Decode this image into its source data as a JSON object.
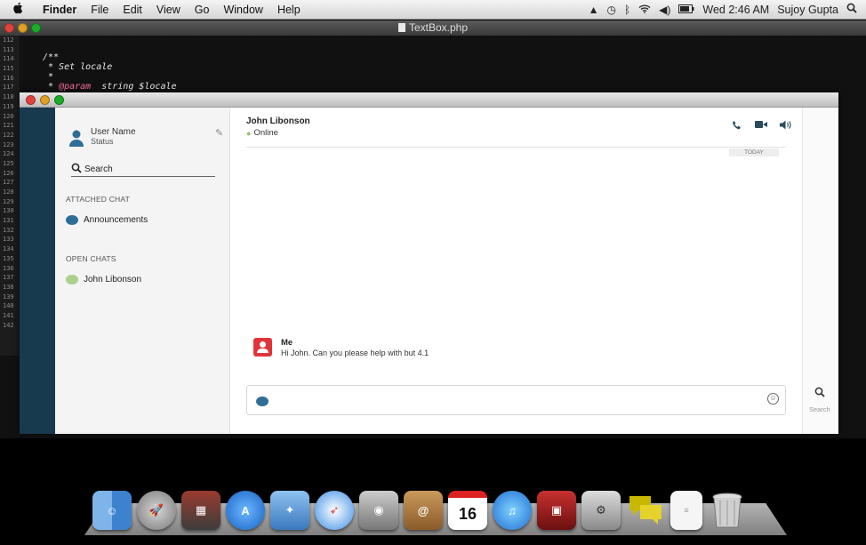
{
  "menubar": {
    "apple": "",
    "items": [
      "Finder",
      "File",
      "Edit",
      "View",
      "Go",
      "Window",
      "Help"
    ],
    "clock": "Wed 2:46 AM",
    "user": "Sujoy Gupta"
  },
  "editor": {
    "title": "TextBox.php",
    "line_numbers": [
      "112",
      "113",
      "114",
      "115",
      "116",
      "117",
      "118",
      "119",
      "120",
      "121",
      "122",
      "123",
      "124",
      "125",
      "126",
      "127",
      "128",
      "129",
      "130",
      "131",
      "132",
      "133",
      "134",
      "135",
      "136",
      "137",
      "138",
      "139",
      "140",
      "141",
      "142"
    ],
    "code": {
      "l1": "/**",
      "l2": " * Set locale",
      "l3": " *",
      "l4_kw": "@param",
      "l4_rest": "  string $locale"
    }
  },
  "chat": {
    "user": {
      "name": "User Name",
      "status": "Status"
    },
    "search_label": "Search",
    "attached_header": "ATTACHED CHAT",
    "attached_items": [
      "Announcements"
    ],
    "open_header": "OPEN CHATS",
    "open_items": [
      "John Libonson"
    ],
    "conversation": {
      "contact_name": "John Libonson",
      "contact_status": "Online",
      "date_divider": "TODAY",
      "messages": [
        {
          "sender": "Me",
          "text": "Hi John. Can you please help with but 4.1"
        }
      ]
    },
    "right_search_label": "Search"
  },
  "dock": {
    "icons": [
      "finder-icon",
      "launchpad-icon",
      "photo-booth-icon",
      "app-store-icon",
      "preview-icon",
      "safari-icon",
      "facetime-icon",
      "address-book-icon",
      "calendar-icon",
      "itunes-icon",
      "photo-gallery-icon",
      "system-preferences-icon",
      "chat-icon",
      "document-icon",
      "trash-icon"
    ],
    "calendar_day": "16"
  },
  "colors": {
    "left_strip": "#173a4f",
    "accent_blue": "#2f6d96",
    "online_green": "#8fc46f",
    "me_avatar": "#e0343a"
  }
}
